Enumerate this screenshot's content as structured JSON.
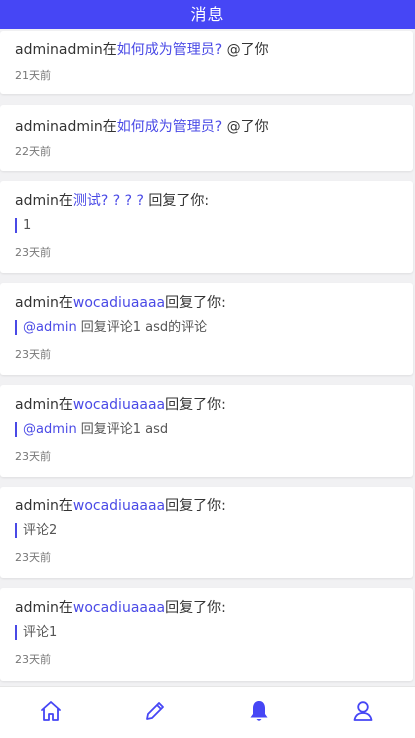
{
  "header": {
    "title": "消息"
  },
  "messages": [
    {
      "user": "adminadmin",
      "in": "在",
      "link": "如何成为管理员?",
      "action": " @了你",
      "reply_mention": "",
      "reply": "",
      "time": "21天前"
    },
    {
      "user": "adminadmin",
      "in": "在",
      "link": "如何成为管理员?",
      "action": " @了你",
      "reply_mention": "",
      "reply": "",
      "time": "22天前"
    },
    {
      "user": "admin",
      "in": "在",
      "link": "测试? ? ? ? ",
      "action": "回复了你:",
      "reply_mention": "",
      "reply": "1",
      "time": "23天前"
    },
    {
      "user": "admin",
      "in": "在",
      "link": "wocadiuaaaa",
      "action": "回复了你:",
      "reply_mention": "@admin",
      "reply": "回复评论1 asd的评论",
      "time": "23天前"
    },
    {
      "user": "admin",
      "in": "在",
      "link": "wocadiuaaaa",
      "action": "回复了你:",
      "reply_mention": "@admin",
      "reply": "回复评论1 asd",
      "time": "23天前"
    },
    {
      "user": "admin",
      "in": "在",
      "link": "wocadiuaaaa",
      "action": "回复了你:",
      "reply_mention": "",
      "reply": "评论2",
      "time": "23天前"
    },
    {
      "user": "admin",
      "in": "在",
      "link": "wocadiuaaaa",
      "action": "回复了你:",
      "reply_mention": "",
      "reply": "评论1",
      "time": "23天前"
    }
  ],
  "tabbar": {
    "items": [
      {
        "icon": "home-icon",
        "active": false
      },
      {
        "icon": "pencil-icon",
        "active": false
      },
      {
        "icon": "bell-icon",
        "active": true
      },
      {
        "icon": "user-icon",
        "active": false
      }
    ]
  },
  "colors": {
    "accent": "#4646f5",
    "link": "#4a4ae6",
    "background": "#f1f1f3"
  }
}
